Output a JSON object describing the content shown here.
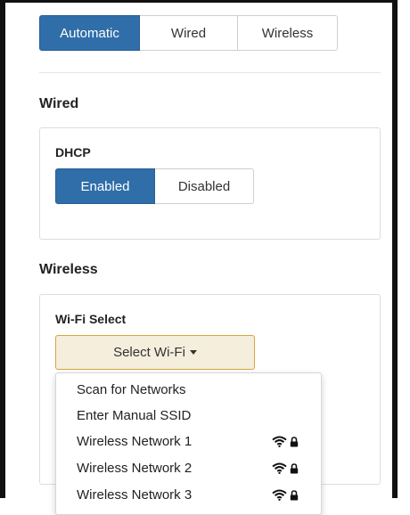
{
  "mode_tabs": [
    {
      "label": "Automatic",
      "active": true
    },
    {
      "label": "Wired",
      "active": false
    },
    {
      "label": "Wireless",
      "active": false
    }
  ],
  "wired": {
    "title": "Wired",
    "dhcp_label": "DHCP",
    "options": [
      {
        "label": "Enabled",
        "active": true
      },
      {
        "label": "Disabled",
        "active": false
      }
    ]
  },
  "wireless": {
    "title": "Wireless",
    "wifi_select_label": "Wi-Fi Select",
    "select_button": "Select Wi-Fi",
    "menu": [
      {
        "label": "Scan for Networks",
        "icons": []
      },
      {
        "label": "Enter Manual SSID",
        "icons": []
      },
      {
        "label": "Wireless Network 1",
        "icons": [
          "wifi-icon",
          "lock-icon"
        ]
      },
      {
        "label": "Wireless Network 2",
        "icons": [
          "wifi-icon",
          "lock-icon"
        ]
      },
      {
        "label": "Wireless Network 3",
        "icons": [
          "wifi-icon",
          "lock-icon"
        ]
      }
    ]
  },
  "colors": {
    "accent": "#2f6ea8",
    "select_border": "#d9a441",
    "select_bg": "#f5eedd"
  }
}
